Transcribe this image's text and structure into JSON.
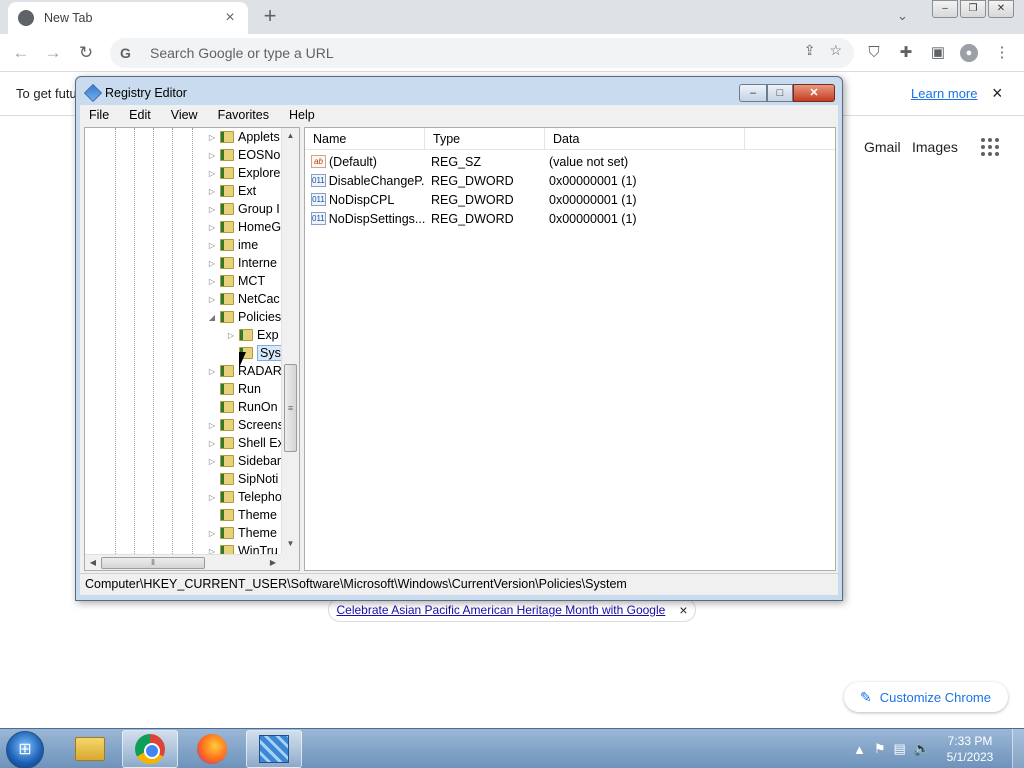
{
  "chrome": {
    "tab_title": "New Tab",
    "tab_close": "×",
    "new_tab": "+",
    "tab_search": "⌄",
    "omnibox_placeholder": "Search Google or type a URL",
    "infobar_text": "To get futu",
    "infobar_learn_more": "Learn more",
    "infobar_close": "×",
    "ntp_links": [
      "Gmail",
      "Images"
    ],
    "doodle_promo": "Celebrate Asian Pacific American Heritage Month with Google",
    "doodle_close": "×",
    "customize_label": "Customize Chrome",
    "colors": {
      "accent": "#1a73e8",
      "tabstrip": "#dee1e6"
    }
  },
  "regedit": {
    "title": "Registry Editor",
    "menu": [
      "File",
      "Edit",
      "View",
      "Favorites",
      "Help"
    ],
    "tree": [
      {
        "label": "Applets",
        "expander": "▷",
        "indent": 1
      },
      {
        "label": "EOSNo",
        "expander": "▷",
        "indent": 1
      },
      {
        "label": "Explore",
        "expander": "▷",
        "indent": 1
      },
      {
        "label": "Ext",
        "expander": "▷",
        "indent": 1
      },
      {
        "label": "Group I",
        "expander": "▷",
        "indent": 1
      },
      {
        "label": "HomeG",
        "expander": "▷",
        "indent": 1
      },
      {
        "label": "ime",
        "expander": "▷",
        "indent": 1
      },
      {
        "label": "Interne",
        "expander": "▷",
        "indent": 1
      },
      {
        "label": "MCT",
        "expander": "▷",
        "indent": 1
      },
      {
        "label": "NetCac",
        "expander": "▷",
        "indent": 1
      },
      {
        "label": "Policies",
        "expander": "◢",
        "indent": 1
      },
      {
        "label": "Exp",
        "expander": "▷",
        "indent": 2
      },
      {
        "label": "Syst",
        "expander": "",
        "indent": 2,
        "selected": true
      },
      {
        "label": "RADAR",
        "expander": "▷",
        "indent": 1
      },
      {
        "label": "Run",
        "expander": "",
        "indent": 1
      },
      {
        "label": "RunOn",
        "expander": "",
        "indent": 1
      },
      {
        "label": "Screens",
        "expander": "▷",
        "indent": 1
      },
      {
        "label": "Shell Ex",
        "expander": "▷",
        "indent": 1
      },
      {
        "label": "Sidebar",
        "expander": "▷",
        "indent": 1
      },
      {
        "label": "SipNoti",
        "expander": "",
        "indent": 1
      },
      {
        "label": "Telepho",
        "expander": "▷",
        "indent": 1
      },
      {
        "label": "Theme",
        "expander": "",
        "indent": 1
      },
      {
        "label": "Theme",
        "expander": "▷",
        "indent": 1
      },
      {
        "label": "WinTru",
        "expander": "▷",
        "indent": 1
      }
    ],
    "columns": [
      "Name",
      "Type",
      "Data"
    ],
    "values": [
      {
        "icon": "ab",
        "kind": "string-value-icon",
        "name": "(Default)",
        "type": "REG_SZ",
        "data": "(value not set)"
      },
      {
        "icon": "011",
        "kind": "dword-value-icon",
        "name": "DisableChangeP...",
        "type": "REG_DWORD",
        "data": "0x00000001 (1)"
      },
      {
        "icon": "011",
        "kind": "dword-value-icon",
        "name": "NoDispCPL",
        "type": "REG_DWORD",
        "data": "0x00000001 (1)"
      },
      {
        "icon": "011",
        "kind": "dword-value-icon",
        "name": "NoDispSettings...",
        "type": "REG_DWORD",
        "data": "0x00000001 (1)"
      }
    ],
    "status_path": "Computer\\HKEY_CURRENT_USER\\Software\\Microsoft\\Windows\\CurrentVersion\\Policies\\System"
  },
  "taskbar": {
    "time": "7:33 PM",
    "date": "5/1/2023"
  }
}
